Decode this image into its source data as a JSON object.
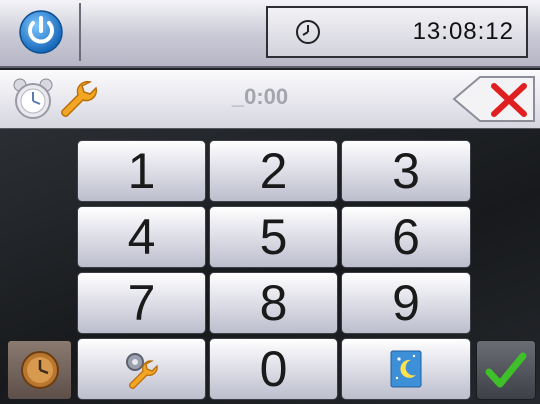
{
  "header": {
    "power_icon": "power-icon",
    "clock_icon": "clock-icon",
    "time": "13:08:12"
  },
  "entry": {
    "alarm_icon": "alarm-clock-icon",
    "wrench_icon": "wrench-icon",
    "value": "_0:00",
    "clear_icon": "backspace-x-icon"
  },
  "keypad": {
    "keys": [
      "1",
      "2",
      "3",
      "4",
      "5",
      "6",
      "7",
      "8",
      "9",
      "0"
    ],
    "settings_icon": "wrench-gear-icon",
    "night_icon": "moon-stars-icon"
  },
  "side": {
    "left_icon": "clock-settings-icon",
    "confirm_icon": "checkmark-icon"
  },
  "colors": {
    "accent_blue": "#1f86d8",
    "confirm_green": "#3fbf2a",
    "clear_red": "#e02020"
  }
}
